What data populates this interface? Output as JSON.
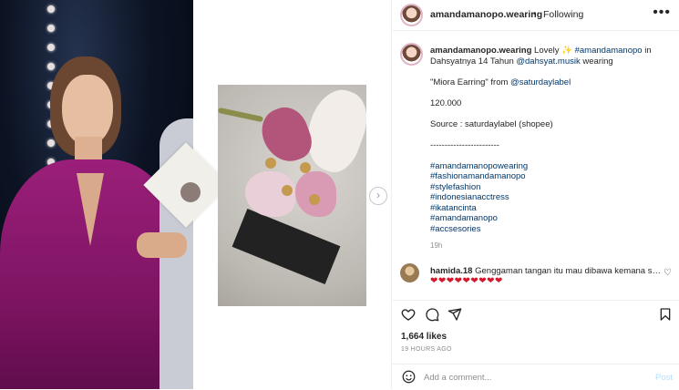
{
  "post": {
    "username": "amandamanopo.wearing",
    "separator": "•",
    "follow_status": "Following",
    "more_label": "•••"
  },
  "caption": {
    "username": "amandamanopo.wearing",
    "intro_text": "Lovely ✨",
    "mention_1": "#amandamanopo",
    "intro_in": "in",
    "event_text": "Dahsyatnya 14 Tahun",
    "mention_2": "@dahsyat.musik",
    "wearing": "wearing",
    "item_text": "\"Miora Earring\" from",
    "mention_3": "@saturdaylabel",
    "price": "120.000",
    "source": "Source : saturdaylabel (shopee)",
    "divider": "------------------------",
    "hashtags": [
      "#amandamanopowearing",
      "#fashionamandamanopo",
      "#stylefashion",
      "#indonesianacctress",
      "#ikatancinta",
      "#amandamanopo",
      "#accsesories"
    ],
    "time": "19h"
  },
  "comment": {
    "username": "hamida.18",
    "text": "Genggaman tangan itu mau dibawa kemana say.....",
    "hearts": "❤❤❤❤❤❤❤❤❤"
  },
  "stats": {
    "likes": "1,664 likes",
    "ago": "19 HOURS AGO"
  },
  "add_comment": {
    "placeholder": "Add a comment...",
    "post_label": "Post"
  },
  "icons": {
    "like": "heart-icon",
    "comment": "comment-icon",
    "share": "share-icon",
    "save": "bookmark-icon",
    "emoji": "emoji-icon",
    "next": "chevron-right-icon"
  },
  "colors": {
    "link": "#00376b",
    "heart": "#d8162a",
    "post_disabled": "#b2dffc"
  }
}
